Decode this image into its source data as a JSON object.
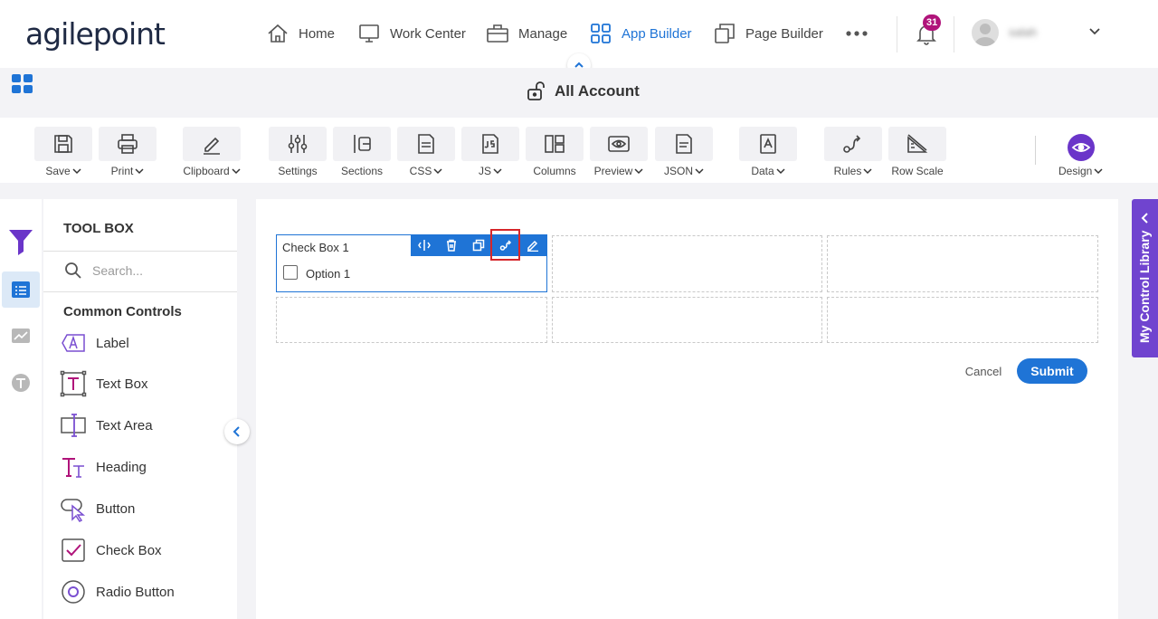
{
  "brand": {
    "logo_text": "agilepoint",
    "accent": "#1f74d6",
    "purple": "#6a35c9",
    "badge": "#b0137a"
  },
  "nav": {
    "items": [
      {
        "label": "Home",
        "icon": "home-icon"
      },
      {
        "label": "Work Center",
        "icon": "monitor-icon"
      },
      {
        "label": "Manage",
        "icon": "briefcase-icon"
      },
      {
        "label": "App Builder",
        "icon": "grid-icon",
        "active": true
      },
      {
        "label": "Page Builder",
        "icon": "pages-icon"
      }
    ],
    "more_icon": "more-dots-icon",
    "notifications_count": "31",
    "user_name": "salah"
  },
  "app": {
    "title": "All Account",
    "title_icon": "unlock-icon"
  },
  "toolbar": {
    "items": [
      {
        "label": "Save",
        "icon": "save-icon",
        "dropdown": true
      },
      {
        "label": "Print",
        "icon": "print-icon",
        "dropdown": true
      },
      {
        "label": "Clipboard",
        "icon": "pencil-icon",
        "dropdown": true
      },
      {
        "label": "Settings",
        "icon": "sliders-icon",
        "dropdown": false
      },
      {
        "label": "Sections",
        "icon": "sections-icon",
        "dropdown": false
      },
      {
        "label": "CSS",
        "icon": "css-file-icon",
        "dropdown": true
      },
      {
        "label": "JS",
        "icon": "js-file-icon",
        "dropdown": true
      },
      {
        "label": "Columns",
        "icon": "columns-icon",
        "dropdown": false
      },
      {
        "label": "Preview",
        "icon": "eye-icon",
        "dropdown": true
      },
      {
        "label": "JSON",
        "icon": "json-file-icon",
        "dropdown": true
      },
      {
        "label": "Data",
        "icon": "data-icon",
        "dropdown": true
      },
      {
        "label": "Rules",
        "icon": "rules-icon",
        "dropdown": true
      },
      {
        "label": "Row Scale",
        "icon": "ruler-icon",
        "dropdown": false
      }
    ],
    "design_label": "Design"
  },
  "toolbox": {
    "title": "TOOL BOX",
    "search_placeholder": "Search...",
    "section": "Common Controls",
    "controls": [
      {
        "label": "Label",
        "icon": "label-icon"
      },
      {
        "label": "Text Box",
        "icon": "textbox-icon"
      },
      {
        "label": "Text Area",
        "icon": "textarea-icon"
      },
      {
        "label": "Heading",
        "icon": "heading-icon"
      },
      {
        "label": "Button",
        "icon": "button-icon"
      },
      {
        "label": "Check Box",
        "icon": "checkbox-icon"
      },
      {
        "label": "Radio Button",
        "icon": "radio-icon"
      }
    ]
  },
  "form": {
    "checkbox_control": {
      "title": "Check Box 1",
      "option": "Option 1",
      "tools": [
        "move-icon",
        "delete-icon",
        "duplicate-icon",
        "rules-link-icon",
        "edit-icon"
      ]
    },
    "cancel_label": "Cancel",
    "submit_label": "Submit"
  },
  "right_panel": {
    "label": "My Control Library"
  }
}
